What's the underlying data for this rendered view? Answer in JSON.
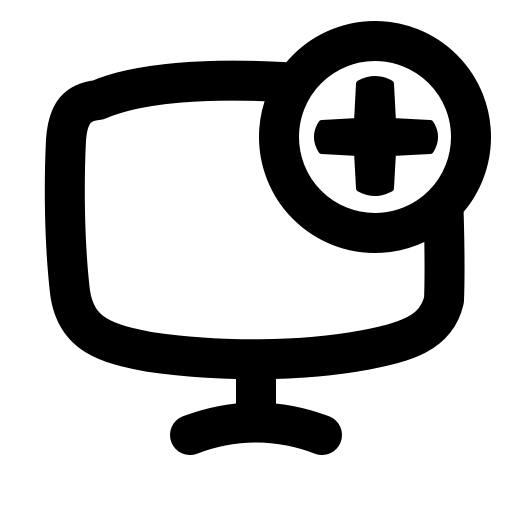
{
  "icon": {
    "name": "tv-add-icon",
    "colors": {
      "stroke": "#000000",
      "background": "#ffffff"
    }
  }
}
